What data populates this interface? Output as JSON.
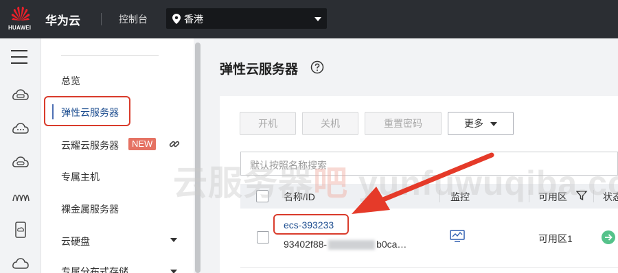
{
  "colors": {
    "topbar": "#2b2e33",
    "accent_blue": "#1b4c8f",
    "highlight_red": "#d93b2b",
    "new_badge": "#e57263",
    "status_green": "#55c28a"
  },
  "header": {
    "logo_text": "HUAWEI",
    "brand": "华为云",
    "console_label": "控制台",
    "region": {
      "icon": "location-pin-icon",
      "label": "香港"
    }
  },
  "rail": {
    "icons": [
      "menu-icon",
      "cloud-server-icon",
      "cloud-chat-icon",
      "cloud-disk-icon",
      "network-wave-icon",
      "mobile-cloud-icon",
      "cloud-icon"
    ]
  },
  "nav": {
    "items": [
      {
        "label": "总览"
      },
      {
        "label": "弹性云服务器",
        "active": true
      },
      {
        "label": "云耀云服务器",
        "badge": "NEW",
        "icon": "link-icon"
      },
      {
        "label": "专属主机"
      },
      {
        "label": "裸金属服务器"
      },
      {
        "label": "云硬盘",
        "expandable": true
      },
      {
        "label": "专属分布式存储",
        "expandable": true
      }
    ]
  },
  "main": {
    "title": "弹性云服务器",
    "help_icon": "question-circle-icon",
    "toolbar": {
      "start": "开机",
      "stop": "关机",
      "reset_password": "重置密码",
      "more": "更多"
    },
    "search": {
      "placeholder": "默认按照名称搜索"
    },
    "table": {
      "columns": [
        "名称/ID",
        "监控",
        "可用区",
        "状态"
      ],
      "rows": [
        {
          "name": "ecs-393233",
          "id_prefix": "93402f88-",
          "id_suffix": "b0ca…",
          "monitor_icon": "monitor-chart-icon",
          "zone": "可用区1",
          "status_icon": "status-running-icon"
        }
      ]
    }
  },
  "watermark": {
    "cn": "云服务器",
    "cn_accent": "吧",
    "latin": "yunfuwuqiba.com"
  }
}
